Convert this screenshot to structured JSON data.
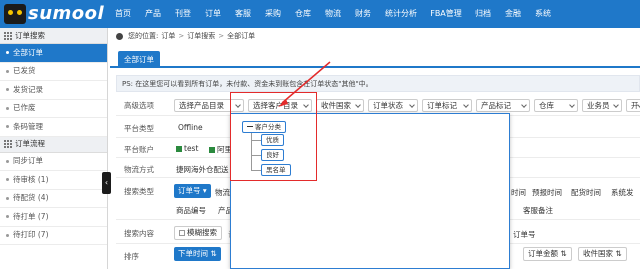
{
  "logo": {
    "word": "sumool",
    "tag": "",
    "cat_icon": "cat-logo-icon"
  },
  "nav": {
    "items": [
      {
        "label": "首页",
        "w": 30
      },
      {
        "label": "产品",
        "w": 30
      },
      {
        "label": "刊登",
        "w": 30
      },
      {
        "label": "订单",
        "w": 30
      },
      {
        "label": "客服",
        "w": 30
      },
      {
        "label": "采购",
        "w": 30
      },
      {
        "label": "仓库",
        "w": 30
      },
      {
        "label": "物流",
        "w": 30
      },
      {
        "label": "财务",
        "w": 30
      },
      {
        "label": "统计分析",
        "w": 46
      },
      {
        "label": "FBA管理",
        "w": 44
      },
      {
        "label": "归档",
        "w": 30
      },
      {
        "label": "金融",
        "w": 30
      },
      {
        "label": "系统",
        "w": 30
      }
    ]
  },
  "sidebar": {
    "section1": {
      "title": "订单搜索",
      "icon": "grid-icon"
    },
    "items1": [
      {
        "label": "全部订单",
        "active": true
      },
      {
        "label": "已发货"
      },
      {
        "label": "发货记录"
      },
      {
        "label": "已作废"
      },
      {
        "label": "条码管理"
      }
    ],
    "section2": {
      "title": "订单流程",
      "icon": "grid-icon"
    },
    "items2": [
      {
        "label": "同步订单"
      },
      {
        "label": "待审核  (1)"
      },
      {
        "label": "待配货  (4)"
      },
      {
        "label": "待打单  (7)"
      },
      {
        "label": "待打印  (7)"
      }
    ],
    "collapse_glyph": "‹"
  },
  "breadcrumb": {
    "prefix": "您的位置:",
    "a": "订单",
    "b": "订单搜索",
    "c": "全部订单",
    "sep": ">"
  },
  "tabs": {
    "active": "全部订单"
  },
  "ps_text": "PS: 在这里您可以看到所有订单，未付款、资金未到账包含在订单状态\"其他\"中。",
  "filters": {
    "advanced_label": "高级选项",
    "dropdowns": [
      "选择产品目录",
      "选择客户目录",
      "收件国家",
      "订单状态",
      "订单标记",
      "产品标记",
      "仓库",
      "业务员",
      "开"
    ],
    "platform_label": "平台类型",
    "platform_value": "Offline",
    "account_label": "平台账户",
    "account_values": [
      "test",
      "阿里巴"
    ],
    "shipping_label": "物流方式",
    "shipping_value": "捷网海外仓配送",
    "shipping_more": "M",
    "search_type_label": "搜索类型",
    "search_type_active": "订单号",
    "search_type_next": "物流跟",
    "search_type_right": [
      "时间",
      "预报时间",
      "配货时间",
      "系统发"
    ],
    "search_type_row2": [
      "商品编号",
      "产品名"
    ],
    "search_type_row2_right": "客服备注",
    "search_content_label": "搜索内容",
    "fuzzy_search": "模糊搜索",
    "fuzzy_more": "请",
    "order_no_right": "订单号",
    "sort_label": "排序",
    "sort_active": "下单时间",
    "sort_buttons": [
      "订单金额",
      "收件国家"
    ]
  },
  "popup": {
    "root": "客户分类",
    "children": [
      "优质",
      "良好",
      "黑名单"
    ]
  }
}
